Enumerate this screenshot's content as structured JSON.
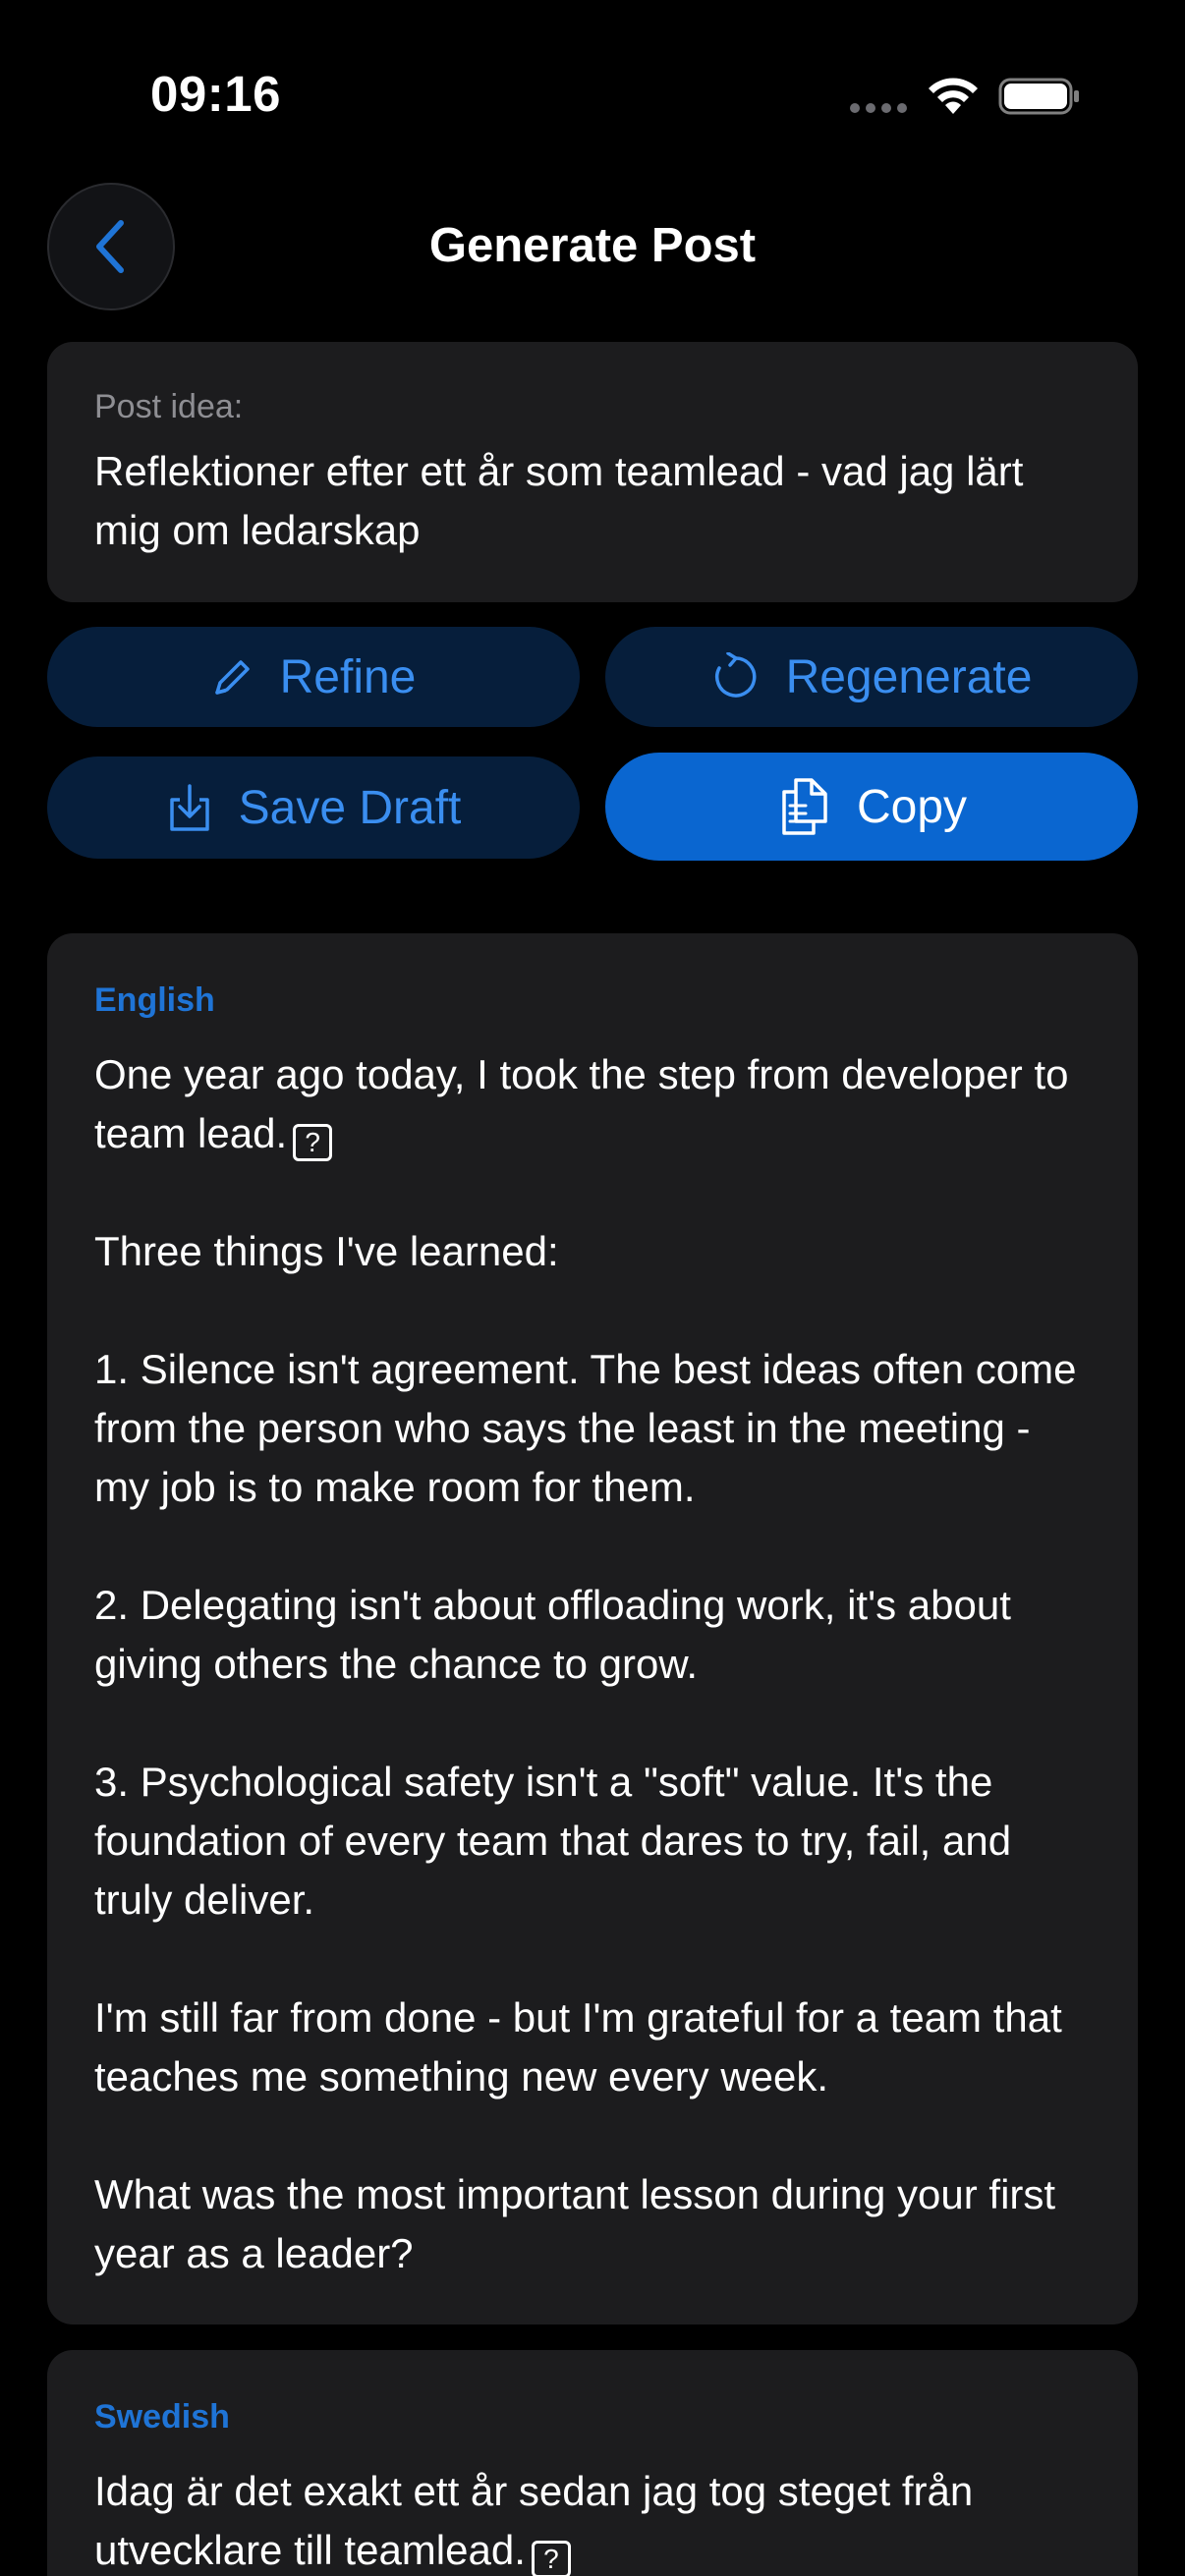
{
  "status_bar": {
    "time": "09:16"
  },
  "header": {
    "title": "Generate Post"
  },
  "idea": {
    "label": "Post idea:",
    "text": "Reflektioner efter ett år som teamlead - vad jag lärt mig om ledarskap"
  },
  "actions": {
    "refine": "Refine",
    "regenerate": "Regenerate",
    "save_draft": "Save Draft",
    "copy": "Copy"
  },
  "posts": {
    "english": {
      "label": "English",
      "line1": "One year ago today, I took the step from developer to team lead.",
      "emoji": "?",
      "rest": "Three things I've learned:\n\n1. Silence isn't agreement. The best ideas often come from the person who says the least in the meeting - my job is to make room for them.\n\n2. Delegating isn't about offloading work, it's about giving others the chance to grow.\n\n3. Psychological safety isn't a \"soft\" value. It's the foundation of every team that dares to try, fail, and truly deliver.\n\nI'm still far from done - but I'm grateful for a team that teaches me something new every week.\n\nWhat was the most important lesson during your first year as a leader?"
    },
    "swedish": {
      "label": "Swedish",
      "line1": "Idag är det exakt ett år sedan jag tog steget från utvecklare till teamlead.",
      "emoji": "?"
    }
  },
  "colors": {
    "accent": "#1f74d6",
    "button_bg": "#061e3b",
    "primary_button": "#0a66d0",
    "card_bg": "#1c1c1e"
  },
  "icons": {
    "back": "chevron-left-icon",
    "refine": "pencil-icon",
    "regenerate": "refresh-icon",
    "save_draft": "download-tray-icon",
    "copy": "copy-icon"
  }
}
